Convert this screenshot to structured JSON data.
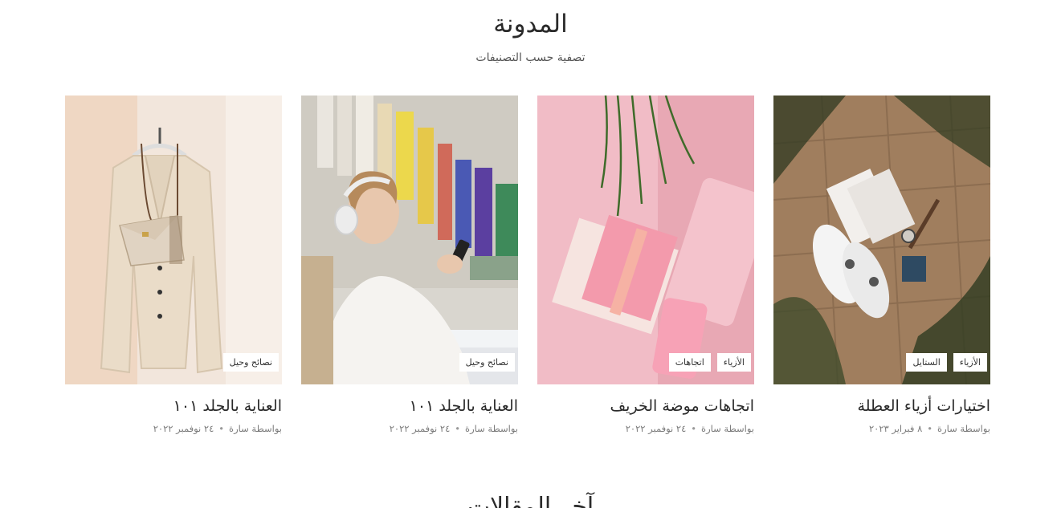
{
  "header": {
    "title": "المدونة",
    "filter_label": "تصفية حسب التصنيفات"
  },
  "posts": [
    {
      "title": "اختيارات أزياء العطلة",
      "author": "بواسطة سارة",
      "date": "٨ فبراير ٢٠٢٣",
      "tags": [
        "الأزياء",
        "الستايل"
      ],
      "image": "white-sneakers-notebook-watch-on-tiles"
    },
    {
      "title": "اتجاهات موضة الخريف",
      "author": "بواسطة سارة",
      "date": "٢٤ نوفمبر ٢٠٢٢",
      "tags": [
        "الأزياء",
        "اتجاهات"
      ],
      "image": "pink-notebooks-and-phone-on-pink-chair"
    },
    {
      "title": "العناية بالجلد ١٠١",
      "author": "بواسطة سارة",
      "date": "٢٤ نوفمبر ٢٠٢٢",
      "tags": [
        "نصائح وحيل"
      ],
      "image": "woman-with-headphones-using-phone"
    },
    {
      "title": "العناية بالجلد ١٠١",
      "author": "بواسطة سارة",
      "date": "٢٤ نوفمبر ٢٠٢٢",
      "tags": [
        "نصائح وحيل"
      ],
      "image": "cream-blazer-with-handbag-on-hanger"
    }
  ],
  "next_section": {
    "title": "آخر المقالات"
  },
  "colors": {
    "background": "#ffffff",
    "text": "#2a2a2a",
    "meta": "#7a7a7a",
    "tag_bg": "#ffffff"
  }
}
